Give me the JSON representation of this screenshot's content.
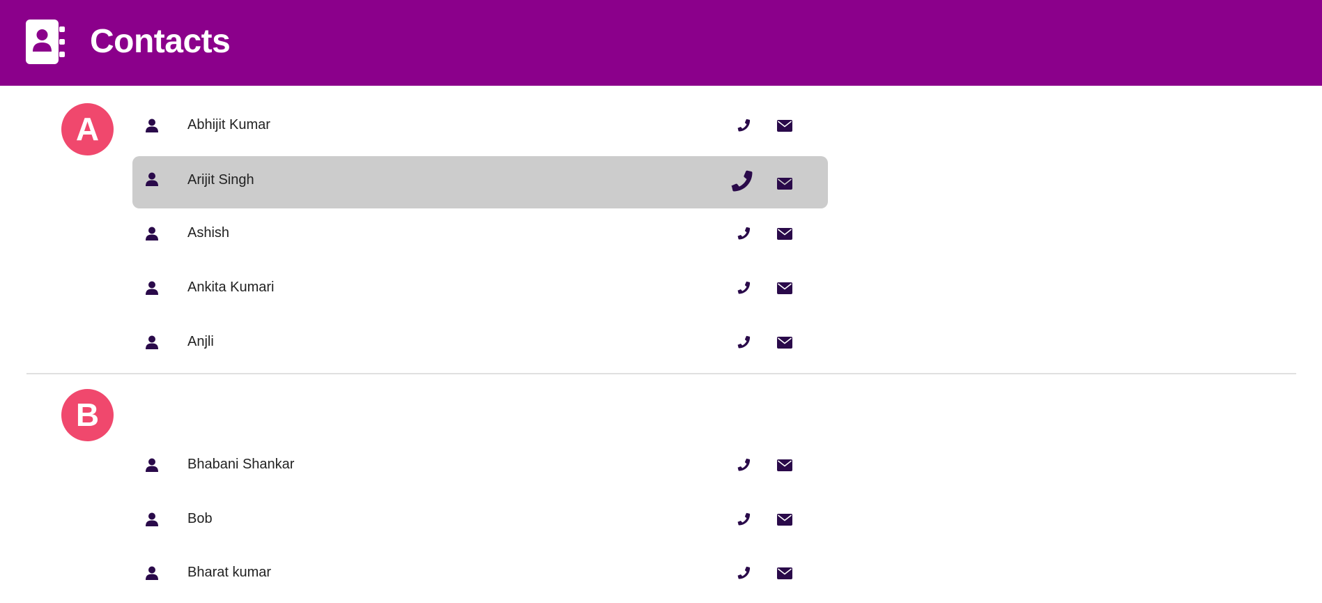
{
  "app": {
    "title": "Contacts",
    "header_color": "#8b008b",
    "badge_color": "#f0486d",
    "icon_color": "#2a0a4a",
    "selected_row_color": "#cccccc"
  },
  "icons": {
    "header": "contacts-book-icon",
    "person": "person-icon",
    "phone": "phone-icon",
    "mail": "envelope-icon"
  },
  "sections": [
    {
      "letter": "A",
      "contacts": [
        {
          "name": "Abhijit Kumar",
          "selected": false
        },
        {
          "name": "Arijit Singh",
          "selected": true
        },
        {
          "name": "Ashish",
          "selected": false
        },
        {
          "name": "Ankita Kumari",
          "selected": false
        },
        {
          "name": "Anjli",
          "selected": false
        }
      ]
    },
    {
      "letter": "B",
      "contacts": [
        {
          "name": "Bhabani Shankar",
          "selected": false
        },
        {
          "name": "Bob",
          "selected": false
        },
        {
          "name": "Bharat kumar",
          "selected": false
        }
      ]
    }
  ]
}
